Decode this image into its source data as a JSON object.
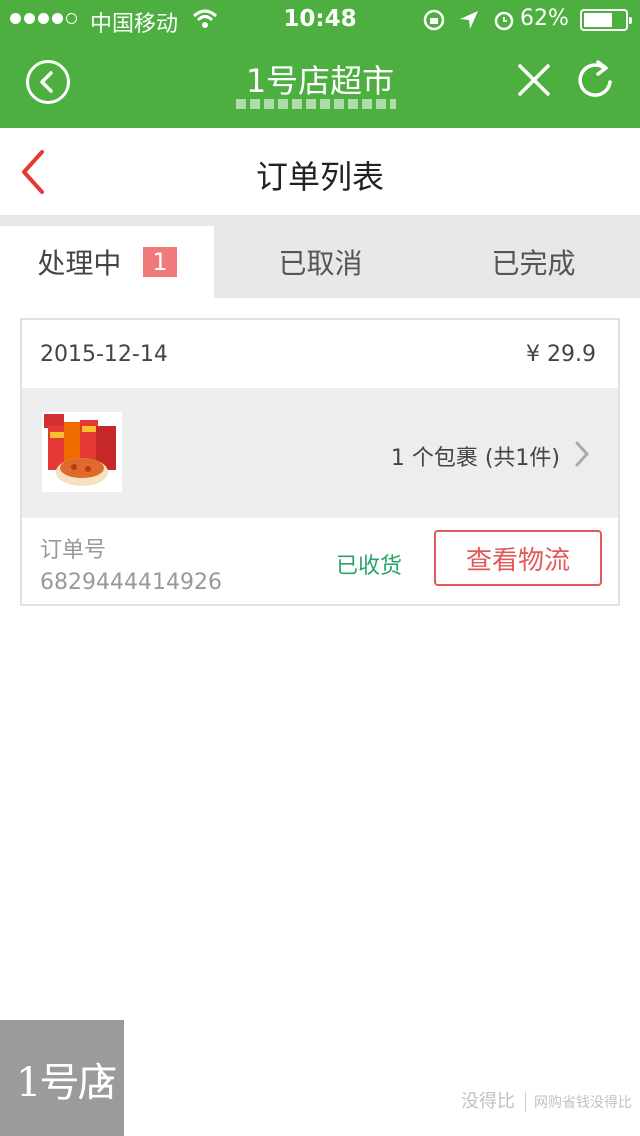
{
  "status_bar": {
    "carrier": "中国移动",
    "time": "10:48",
    "battery_percent": "62%",
    "battery_level": 0.62
  },
  "app_bar": {
    "title": "1号店超市",
    "icons": [
      "back-circle-icon",
      "close-icon",
      "refresh-icon"
    ]
  },
  "header": {
    "title": "订单列表",
    "back_icon": "chevron-left-icon"
  },
  "tabs": [
    {
      "label": "处理中",
      "badge": "1",
      "active": true
    },
    {
      "label": "已取消",
      "active": false
    },
    {
      "label": "已完成",
      "active": false
    }
  ],
  "order": {
    "date": "2015-12-14",
    "price": "¥ 29.9",
    "package_summary": "1 个包裹 (共1件)",
    "order_number_label": "订单号",
    "order_number": "6829444414926",
    "status": "已收货",
    "logistics_button": "查看物流"
  },
  "floating_store": {
    "label": "1号店"
  },
  "watermark": {
    "line1": "没得比",
    "line2": "网购省钱没得比"
  },
  "colors": {
    "brand_green": "#4caf3f",
    "accent_red": "#e05a5a",
    "status_green": "#2aa36a",
    "badge": "#f0797a"
  }
}
